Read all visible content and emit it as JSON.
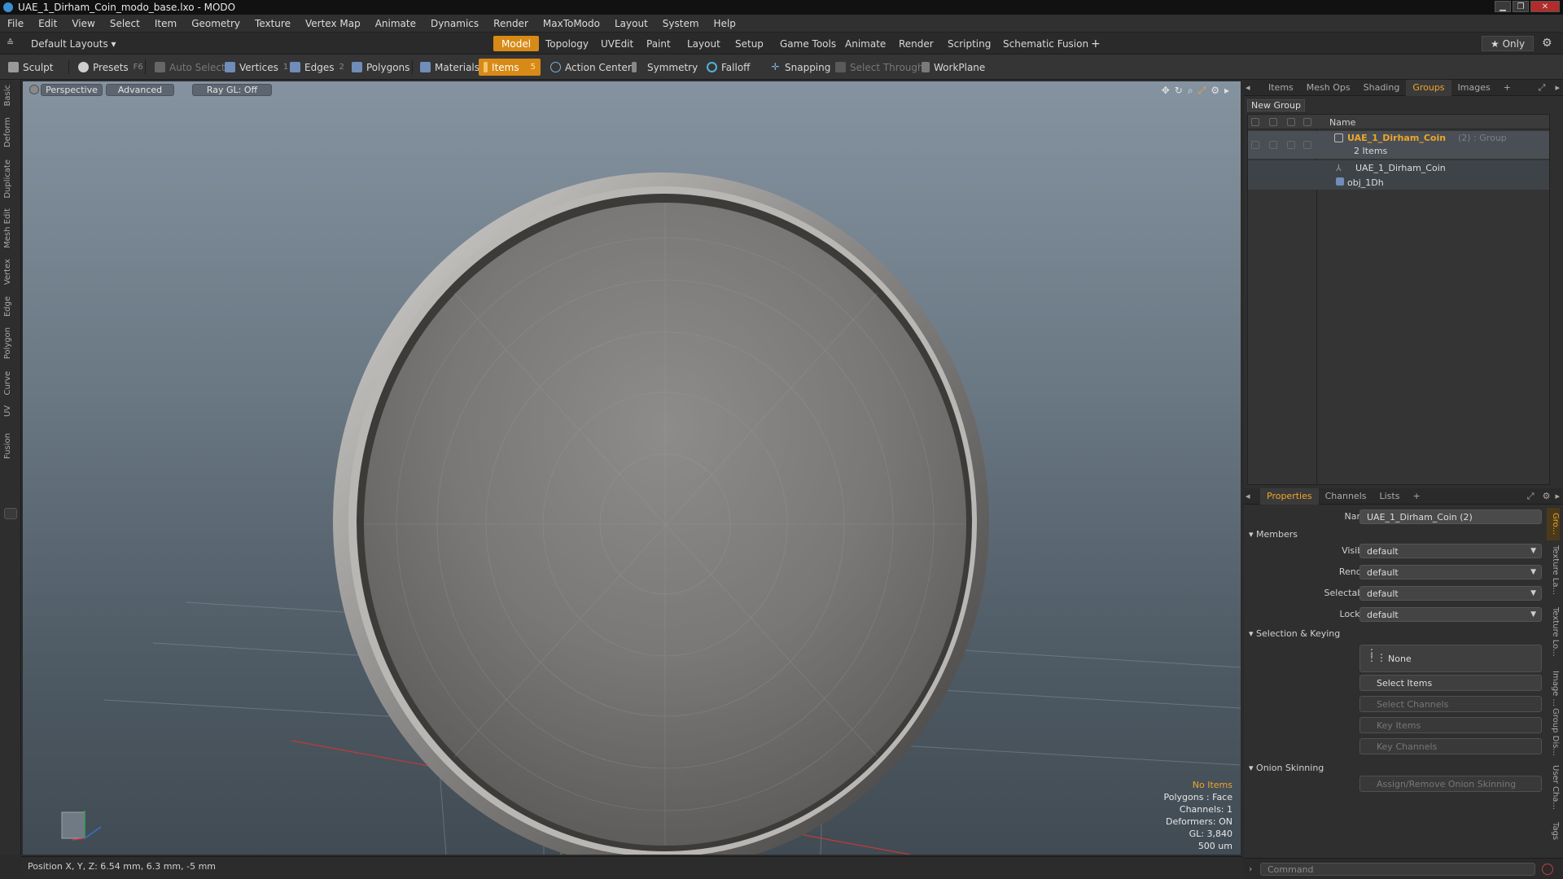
{
  "window": {
    "title": "UAE_1_Dirham_Coin_modo_base.lxo - MODO"
  },
  "menu": [
    "File",
    "Edit",
    "View",
    "Select",
    "Item",
    "Geometry",
    "Texture",
    "Vertex Map",
    "Animate",
    "Dynamics",
    "Render",
    "MaxToModo",
    "Layout",
    "System",
    "Help"
  ],
  "layoutbar": {
    "preset": "Default Layouts ▾",
    "tabs": [
      "Model",
      "Topology",
      "UVEdit",
      "Paint",
      "Layout",
      "Setup",
      "Game Tools",
      "Animate",
      "Render",
      "Scripting",
      "Schematic Fusion"
    ],
    "add": "+",
    "only": "★ Only"
  },
  "toolbar": {
    "sculpt": "Sculpt",
    "presets": "Presets",
    "presets_key": "F6",
    "auto_select": "Auto Select",
    "vertices": "Vertices",
    "vertices_key": "1",
    "edges": "Edges",
    "edges_key": "2",
    "polygons": "Polygons",
    "materials": "Materials",
    "items": "Items",
    "items_key": "5",
    "action_center": "Action Center",
    "symmetry": "Symmetry",
    "falloff": "Falloff",
    "snapping": "Snapping",
    "select_through": "Select Through",
    "workplane": "WorkPlane"
  },
  "lefttabs": [
    "Basic",
    "Deform",
    "Duplicate",
    "Mesh Edit",
    "Vertex",
    "Edge",
    "Polygon",
    "Curve",
    "UV",
    "Fusion"
  ],
  "viewport": {
    "perspective": "Perspective",
    "advanced": "Advanced",
    "raygl": "Ray GL: Off",
    "hud": {
      "selection": "No Items",
      "polygons": "Polygons : Face",
      "channels": "Channels: 1",
      "deformers": "Deformers: ON",
      "gl": "GL: 3,840",
      "scale": "500 um"
    },
    "colors": {
      "selection_text": "#f0a52a"
    }
  },
  "status": {
    "position": "Position X, Y, Z:  6.54 mm, 6.3 mm, -5 mm"
  },
  "rightpanel": {
    "tabs": [
      "Items",
      "Mesh Ops",
      "Shading",
      "Groups",
      "Images"
    ],
    "active_tab": "Groups",
    "add": "+",
    "new_group": "New Group",
    "col_name": "Name",
    "group": {
      "name": "UAE_1_Dirham_Coin",
      "suffix": "(2) : Group",
      "count": "2 Items",
      "children": [
        "UAE_1_Dirham_Coin",
        "obj_1Dh"
      ]
    }
  },
  "properties": {
    "tabs": [
      "Properties",
      "Channels",
      "Lists"
    ],
    "add": "+",
    "name_label": "Name",
    "name_value": "UAE_1_Dirham_Coin (2)",
    "members": "Members",
    "rows": [
      {
        "label": "Visible",
        "value": "default"
      },
      {
        "label": "Render",
        "value": "default"
      },
      {
        "label": "Selectable",
        "value": "default"
      },
      {
        "label": "Locked",
        "value": "default"
      }
    ],
    "selection_keying": "Selection & Keying",
    "none": "None",
    "select_items": "Select Items",
    "select_channels": "Select Channels",
    "key_items": "Key Items",
    "key_channels": "Key Channels",
    "onion": "Onion Skinning",
    "assign_onion": "Assign/Remove Onion Skinning",
    "side_tabs": [
      "Gro...",
      "Texture La...",
      "Texture Lo...",
      "Image ...",
      "Group Dis...",
      "User Cha...",
      "Tags"
    ]
  },
  "command": {
    "placeholder": "Command"
  }
}
